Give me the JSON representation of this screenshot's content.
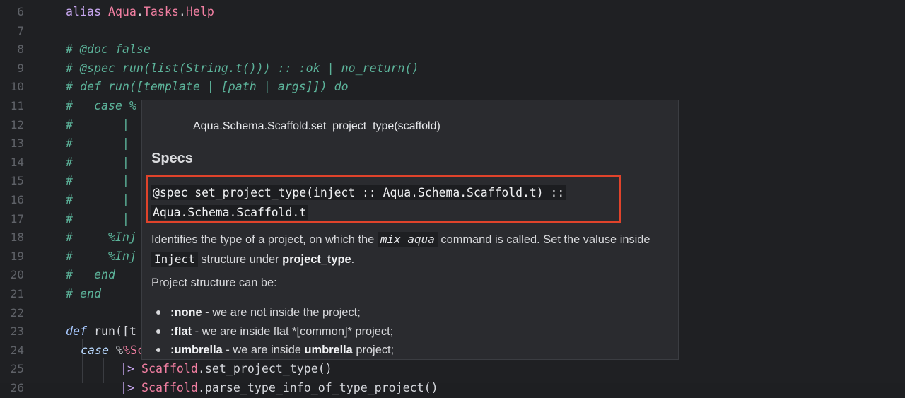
{
  "editor": {
    "lines": [
      {
        "num": "6"
      },
      {
        "num": "7"
      },
      {
        "num": "8"
      },
      {
        "num": "9"
      },
      {
        "num": "10"
      },
      {
        "num": "11"
      },
      {
        "num": "12"
      },
      {
        "num": "13"
      },
      {
        "num": "14"
      },
      {
        "num": "15"
      },
      {
        "num": "16"
      },
      {
        "num": "17"
      },
      {
        "num": "18"
      },
      {
        "num": "19"
      },
      {
        "num": "20"
      },
      {
        "num": "21"
      },
      {
        "num": "22"
      },
      {
        "num": "23"
      },
      {
        "num": "24"
      },
      {
        "num": "25"
      },
      {
        "num": "26"
      }
    ],
    "code": {
      "l6_kw": "alias",
      "l6_mod": "Aqua",
      "l6_mod2": "Tasks",
      "l6_mod3": "Help",
      "l8": "# @doc false",
      "l9": "# @spec run(list(String.t())) :: :ok | no_return()",
      "l10": "# def run([template | [path | args]]) do",
      "l11": "#   case %",
      "l12": "#       |",
      "l13": "#       |",
      "l14": "#       |",
      "l15": "#       |",
      "l16": "#       |",
      "l17": "#       |",
      "l18": "#     %Inj",
      "l19": "#     %Inj",
      "l20": "#   end",
      "l21": "# end",
      "l23_kw": "def",
      "l23_rest": "run([t",
      "l24_kw": "case",
      "l24_rest": "%Sc",
      "l25_op": "|>",
      "l25_mod": "Scaffold",
      "l25_rest": ".set_project_type()",
      "l26_op": "|>",
      "l26_mod": "Scaffold",
      "l26_rest": ".parse_type_info_of_type_project()"
    }
  },
  "hover": {
    "signature": "Aqua.Schema.Scaffold.set_project_type(scaffold)",
    "specs_heading": "Specs",
    "spec_line1": "@spec set_project_type(inject :: Aqua.Schema.Scaffold.t) ::",
    "spec_line2": "Aqua.Schema.Scaffold.t",
    "desc_part1": "Identifies the type of a project, on which the ",
    "desc_code1": "mix aqua",
    "desc_part2": " command is called. Set the valuse inside ",
    "desc_code2": "Inject",
    "desc_part3": " structure under ",
    "desc_bold": "project_type",
    "desc_part4": ".",
    "para2": "Project structure can be:",
    "bullets": [
      {
        "bold": ":none",
        "text": " - we are not inside the project;"
      },
      {
        "bold": ":flat",
        "text": " - we are inside flat *[common]* project;"
      },
      {
        "bold": ":umbrella",
        "text": " - we are inside ",
        "bold2": "umbrella",
        "text2": " project;"
      }
    ]
  }
}
